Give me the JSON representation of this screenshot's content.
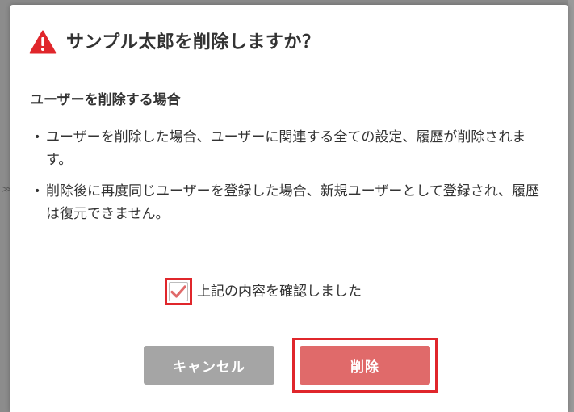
{
  "dialog": {
    "title": "サンプル太郎を削除しますか？",
    "title_icon": "warning-triangle-icon",
    "section_title": "ユーザーを削除する場合",
    "bullets": [
      "ユーザーを削除した場合、ユーザーに関連する全ての設定、履歴が削除されます。",
      "削除後に再度同じユーザーを登録した場合、新規ユーザーとして登録され、履歴は復元できません。"
    ],
    "bullet_mark": "•",
    "confirm_label": "上記の内容を確認しました",
    "confirm_checked": true,
    "cancel_label": "キャンセル",
    "delete_label": "削除"
  },
  "background_edge_glyph": "≫",
  "colors": {
    "warning": "#e0262b",
    "check": "#e06a6a",
    "cancel_button": "#a5a5a5",
    "delete_button": "#e06a6a",
    "highlight_frame": "#e0262b"
  }
}
